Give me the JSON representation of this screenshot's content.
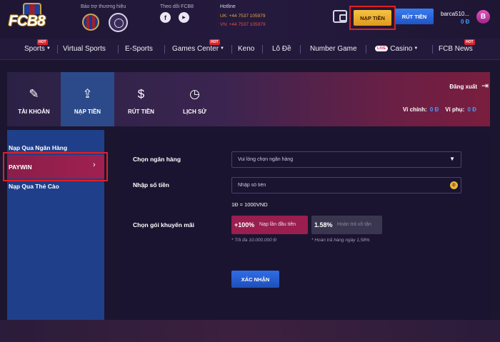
{
  "header": {
    "logo_text": "FCB8",
    "sponsor_label": "Bảo trợ thương hiệu",
    "follow_label": "Theo dõi FCB8",
    "social": [
      {
        "icon": "facebook-icon",
        "glyph": "f"
      },
      {
        "icon": "youtube-icon",
        "glyph": "▶"
      }
    ],
    "hotline_label": "Hotline",
    "hotline_uk": "UK: +44 7537 105979",
    "hotline_vn": "VN: +44 7537 105979",
    "deposit_label": "NẠP TIỀN",
    "withdraw_label": "RÚT TIỀN",
    "username": "barca510...",
    "balance": "0 Đ",
    "avatar_letter": "B"
  },
  "nav": {
    "items": [
      {
        "label": "Sports",
        "hot": true,
        "caret": true
      },
      {
        "label": "Virtual Sports",
        "hot": false,
        "caret": false
      },
      {
        "label": "E-Sports",
        "hot": false,
        "caret": false
      },
      {
        "label": "Games Center",
        "hot": true,
        "caret": true
      },
      {
        "label": "Keno",
        "hot": false,
        "caret": false
      },
      {
        "label": "Lô Đề",
        "hot": false,
        "caret": false
      },
      {
        "label": "Number Game",
        "hot": false,
        "caret": false
      },
      {
        "label": "Casino",
        "hot": false,
        "caret": true,
        "live": "LIVE"
      },
      {
        "label": "FCB News",
        "hot": true,
        "caret": false
      }
    ],
    "hot_label": "HOT"
  },
  "account": {
    "tabs": [
      {
        "label": "TÀI KHOẢN",
        "icon": "pencil-icon",
        "glyph": "✎"
      },
      {
        "label": "NẠP TIỀN",
        "icon": "deposit-icon",
        "glyph": "⇪"
      },
      {
        "label": "RÚT TIỀN",
        "icon": "withdraw-icon",
        "glyph": "$"
      },
      {
        "label": "LỊCH SỬ",
        "icon": "history-icon",
        "glyph": "◷"
      }
    ],
    "active_tab": 1,
    "logout_label": "Đăng xuất",
    "main_wallet_label": "Ví chính:",
    "main_wallet_value": "0 Đ",
    "sub_wallet_label": "Ví phụ:",
    "sub_wallet_value": "0 Đ"
  },
  "side_menu": {
    "items": [
      "Nạp Qua Ngân Hàng",
      "PAYWIN",
      "Nạp Qua Thẻ Cào"
    ],
    "active": 1
  },
  "form": {
    "bank_label": "Chọn ngân hàng",
    "bank_placeholder": "Vui lòng chọn ngân hàng",
    "amount_label": "Nhập số tiền",
    "amount_placeholder": "Nhập số tiền",
    "amount_value": "",
    "rate": "1Đ = 1000VND",
    "promo_label": "Chọn gói khuyến mãi",
    "promos": [
      {
        "value": "+100%",
        "text": "Nạp lần đầu tiên",
        "note": "* Tối đa 10.000.000 Đ"
      },
      {
        "value": "1.58%",
        "text": "Hoàn trả vô tận",
        "note": "* Hoàn trả hàng ngày 1,58%"
      }
    ],
    "confirm_label": "XÁC NHẬN"
  },
  "colors": {
    "accent_blue": "#3b9cff",
    "deposit_gold": "#f6c244",
    "active_magenta": "#9a1e4e",
    "highlight_red": "#e02020"
  }
}
